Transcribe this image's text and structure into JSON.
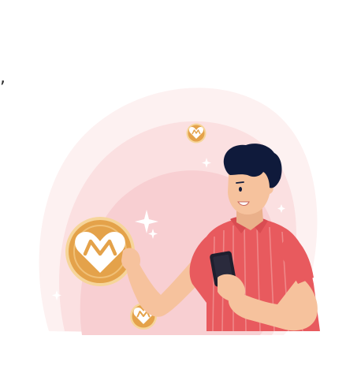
{
  "illustration": {
    "subject": "person-with-phone-receiving-coins",
    "coin_emblem": "heart-m-logo",
    "colors": {
      "background_blob_outer": "#fdf1f1",
      "background_blob_mid": "#fbe0e1",
      "background_blob_inner": "#f8cfd2",
      "coin_gold": "#e4a24a",
      "coin_rim": "#f6d59a",
      "coin_emblem": "#ffffff",
      "shirt": "#e85a5e",
      "shirt_stripe": "#f08c8d",
      "skin": "#f6c29d",
      "hair": "#0f1a3b",
      "phone": "#1f1f2e",
      "sparkle": "#ffffff"
    }
  },
  "page": {
    "stray_char": ","
  }
}
